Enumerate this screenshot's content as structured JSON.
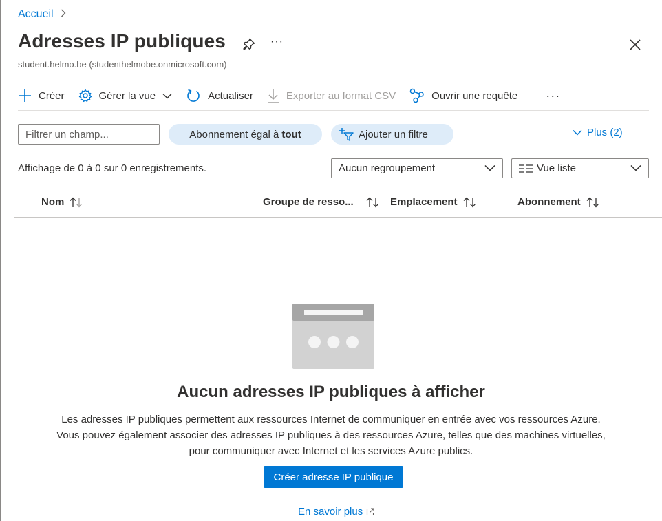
{
  "breadcrumb": {
    "home": "Accueil"
  },
  "page": {
    "title": "Adresses IP publiques",
    "more": "···",
    "subtitle": "student.helmo.be (studenthelmobe.onmicrosoft.com)"
  },
  "toolbar": {
    "create": "Créer",
    "manage_view": "Gérer la vue",
    "refresh": "Actualiser",
    "export_csv": "Exporter au format CSV",
    "open_query": "Ouvrir une requête",
    "more": "···"
  },
  "filters": {
    "placeholder": "Filtrer un champ...",
    "subscription_prefix": "Abonnement égal à",
    "subscription_value": "tout",
    "add_filter": "Ajouter un filtre",
    "more": "Plus (2)"
  },
  "list": {
    "count_text": "Affichage de 0 à 0 sur 0 enregistrements.",
    "grouping": "Aucun regroupement",
    "view_mode": "Vue liste",
    "columns": {
      "name": "Nom",
      "resource_group": "Groupe de resso...",
      "location": "Emplacement",
      "subscription": "Abonnement"
    }
  },
  "empty_state": {
    "title": "Aucun adresses IP publiques à afficher",
    "line1": "Les adresses IP publiques permettent aux ressources Internet de communiquer en entrée avec vos ressources Azure.",
    "line2": "Vous pouvez également associer des adresses IP publiques à des ressources Azure, telles que des machines virtuelles,",
    "line3": "pour communiquer avec Internet et les services Azure publics.",
    "cta": "Créer adresse IP publique",
    "learn_more": "En savoir plus"
  },
  "colors": {
    "accent": "#0078d4",
    "pill_bg": "#deecf9",
    "text": "#323130",
    "disabled": "#a19f9d"
  }
}
